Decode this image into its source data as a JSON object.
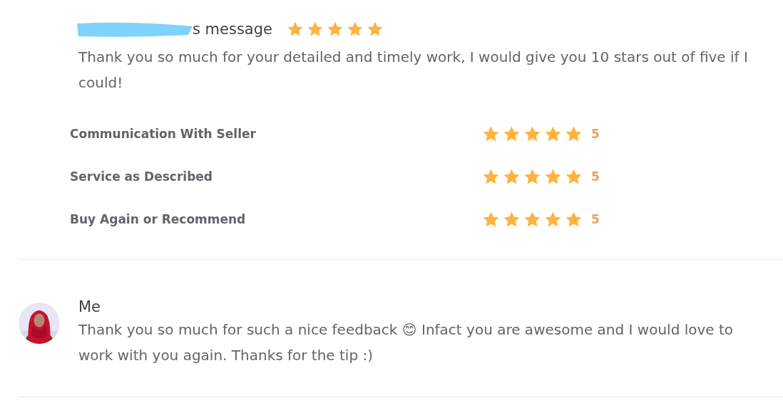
{
  "review": {
    "heading": "s message",
    "stars": 5,
    "text": "Thank you so much for your detailed and timely work, I would give you 10 stars out of five if I could!",
    "ratings": [
      {
        "label": "Communication With Seller",
        "stars": 5,
        "score": "5"
      },
      {
        "label": "Service as Described",
        "stars": 5,
        "score": "5"
      },
      {
        "label": "Buy Again or Recommend",
        "stars": 5,
        "score": "5"
      }
    ]
  },
  "reply": {
    "author": "Me",
    "text": "Thank you so much for such a nice feedback 😊 Infact you are awesome and I would love to work with you again. Thanks for the tip :)"
  }
}
